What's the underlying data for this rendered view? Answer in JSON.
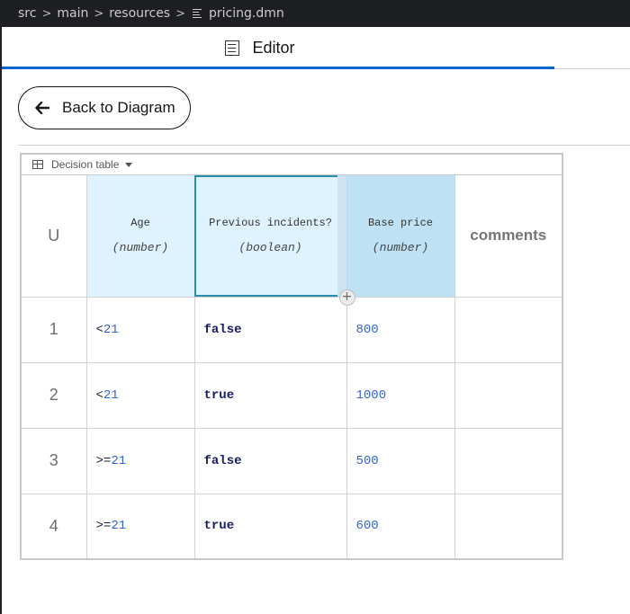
{
  "breadcrumb": {
    "items": [
      "src",
      "main",
      "resources"
    ],
    "file": "pricing.dmn"
  },
  "tabs": [
    {
      "label": "Editor",
      "icon": "editor-icon",
      "active": true
    }
  ],
  "back_button": {
    "label": "Back to Diagram",
    "icon": "arrow-left-icon"
  },
  "decision_table": {
    "label": "Decision table",
    "hit_policy": "U",
    "inputs": [
      {
        "name": "Age",
        "type": "(number)"
      },
      {
        "name": "Previous incidents?",
        "type": "(boolean)"
      }
    ],
    "output": {
      "name": "Base price",
      "type": "(number)"
    },
    "annotation_header": "comments",
    "rules": [
      {
        "number": "1",
        "age_op": "<",
        "age_val": "21",
        "incidents": "false",
        "price": "800",
        "comment": ""
      },
      {
        "number": "2",
        "age_op": "<",
        "age_val": "21",
        "incidents": "true",
        "price": "1000",
        "comment": ""
      },
      {
        "number": "3",
        "age_op": ">=",
        "age_val": "21",
        "incidents": "false",
        "price": "500",
        "comment": ""
      },
      {
        "number": "4",
        "age_op": ">=",
        "age_val": "21",
        "incidents": "true",
        "price": "600",
        "comment": ""
      }
    ]
  },
  "colors": {
    "accent": "#0066cc",
    "input_header": "#def3ff",
    "output_header": "#bee1f4",
    "selected_outline": "#2b8ea8"
  }
}
